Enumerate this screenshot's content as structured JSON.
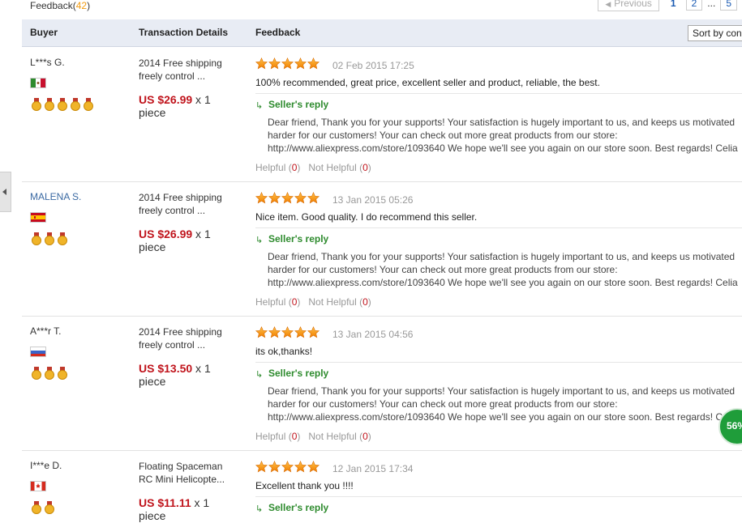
{
  "header": {
    "feedback_label": "Feedback",
    "feedback_count": "42",
    "pager": {
      "previous": "Previous",
      "current": "1",
      "page2": "2",
      "dots": "...",
      "page5": "5"
    },
    "columns": {
      "buyer": "Buyer",
      "transaction": "Transaction Details",
      "feedback": "Feedback"
    },
    "sort_label": "Sort by con"
  },
  "common": {
    "reply_label": "Seller's reply",
    "helpful": "Helpful (",
    "not_helpful": "Not Helpful (",
    "close_paren": ")",
    "reply_text_1": "Dear friend, Thank you for your supports! Your satisfaction is hugely important to us, and keeps us motivated",
    "reply_text_2": "harder for our customers! Your can check out more great products from our store:",
    "reply_text_3": "http://www.aliexpress.com/store/1093640 We hope we'll see you again on our store soon. Best regards! Celia"
  },
  "rows": [
    {
      "buyer": "L***s G.",
      "country": "Mexico",
      "medals": 5,
      "title_line1": "2014 Free shipping",
      "title_line2": "freely control ...",
      "price": "US $26.99",
      "qty": " x 1",
      "unit": "piece",
      "stars": 5,
      "date": "02 Feb 2015 17:25",
      "comment": "100% recommended, great price, excellent seller and product, reliable, the best.",
      "helpful_count": "0",
      "not_helpful_count": "0"
    },
    {
      "buyer": "MALENA S.",
      "country": "Spain",
      "medals": 3,
      "title_line1": "2014 Free shipping",
      "title_line2": "freely control ...",
      "price": "US $26.99",
      "qty": " x 1",
      "unit": "piece",
      "stars": 5,
      "date": "13 Jan 2015 05:26",
      "comment": "Nice item. Good quality. I do recommend this seller.",
      "helpful_count": "0",
      "not_helpful_count": "0"
    },
    {
      "buyer": "A***r T.",
      "country": "Russia",
      "medals": 3,
      "title_line1": "2014 Free shipping",
      "title_line2": "freely control ...",
      "price": "US $13.50",
      "qty": " x 1",
      "unit": "piece",
      "stars": 5,
      "date": "13 Jan 2015 04:56",
      "comment": "its ok,thanks!",
      "helpful_count": "0",
      "not_helpful_count": "0"
    },
    {
      "buyer": "I***e D.",
      "country": "Canada",
      "medals": 2,
      "title_line1": "Floating Spaceman",
      "title_line2": "RC Mini Helicopte...",
      "price": "US $11.11",
      "qty": " x 1",
      "unit": "piece",
      "stars": 5,
      "date": "12 Jan 2015 17:34",
      "comment": "Excellent thank you !!!!"
    }
  ],
  "badge": {
    "percent": "56%"
  },
  "colors": {
    "accent_count": "#f39c12",
    "price": "#c0141c",
    "reply": "#2e8b2e",
    "link": "#3b6aa3"
  }
}
